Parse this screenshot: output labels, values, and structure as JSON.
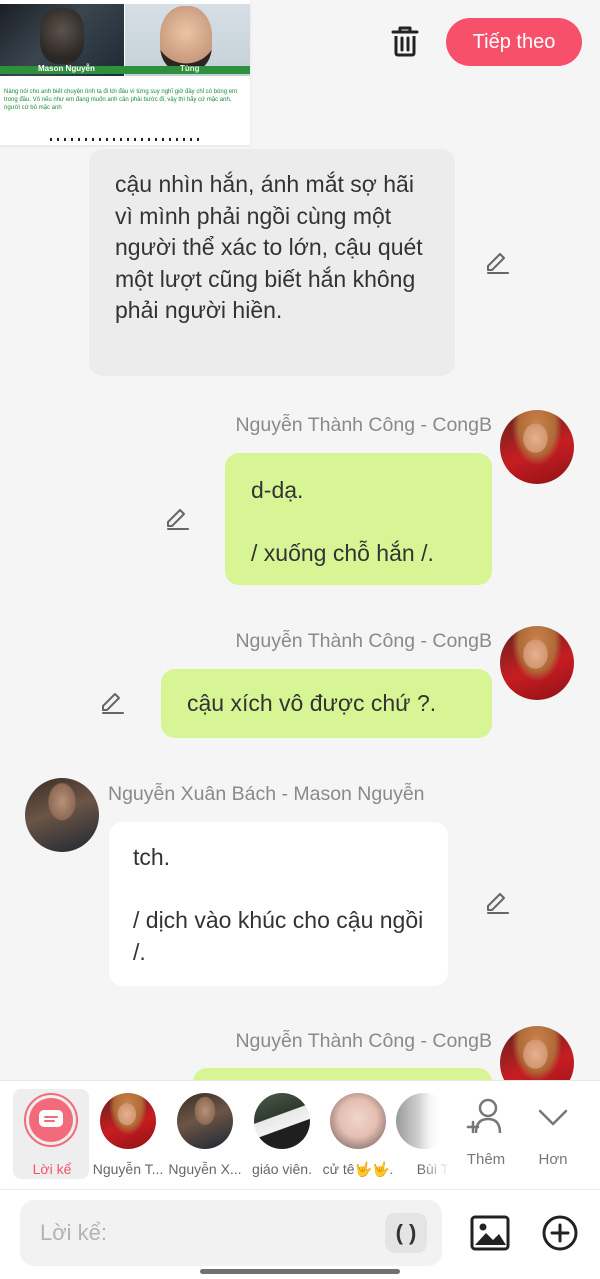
{
  "header": {
    "next_button": "Tiếp theo",
    "cover": {
      "name_left": "Mason Nguyễn",
      "name_right": "Tùng",
      "story_text": "Nàng nói cho anh biết chuyện tình ta đi tới đâu vì từng suy nghĩ giờ đây chỉ có bóng em trong đầu. Vô nếu như em đang muốn anh cần phải bước đi, vậy thì hãy cứ mặc anh, người cứ bỏ mặc anh"
    }
  },
  "messages": [
    {
      "type": "narration",
      "text": "cậu nhìn hắn, ánh mắt sợ hãi vì mình phải ngồi cùng một người thể xác to lớn, cậu quét một lượt cũng biết hắn không phải người hiền."
    },
    {
      "type": "right",
      "sender": "Nguyễn Thành Công - CongB",
      "text": "d-dạ.\n\n/ xuống chỗ hắn /."
    },
    {
      "type": "right",
      "sender": "Nguyễn Thành Công - CongB",
      "text": "cậu xích vô được chứ ?."
    },
    {
      "type": "left",
      "sender": "Nguyễn Xuân Bách - Mason Nguyễn",
      "text": "tch.\n\n/ dịch vào khúc cho cậu ngồi /."
    },
    {
      "type": "right",
      "sender": "Nguyễn Thành Công - CongB",
      "text": ""
    }
  ],
  "characters": [
    {
      "label": "Lời kể"
    },
    {
      "label": "Nguyễn T..."
    },
    {
      "label": "Nguyễn X..."
    },
    {
      "label": "giáo viên."
    },
    {
      "label": "cử tê🤟🤟."
    },
    {
      "label": "Bùi Tr"
    }
  ],
  "actions": {
    "add_label": "Thêm",
    "more_label": "Hơn"
  },
  "input": {
    "placeholder": "Lời kể:",
    "paren_label": "( )"
  },
  "colors": {
    "accent": "#f6506b",
    "green_bubble": "#d7f595",
    "narration_bubble": "#ececec",
    "white_bubble": "#ffffff"
  }
}
